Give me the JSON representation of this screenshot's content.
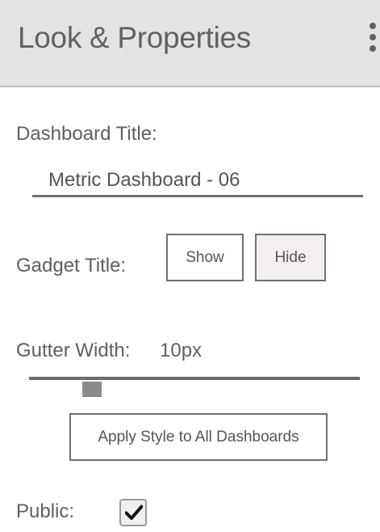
{
  "header": {
    "title": "Look & Properties",
    "menu_icon": "kebab-menu-icon"
  },
  "dashboard_title": {
    "label": "Dashboard Title:",
    "value": "Metric Dashboard - 06"
  },
  "gadget_title": {
    "label": "Gadget Title:",
    "show_label": "Show",
    "hide_label": "Hide",
    "selected": "Hide"
  },
  "gutter_width": {
    "label": "Gutter Width:",
    "value_text": "10px",
    "slider_level": 0.17
  },
  "apply_button": {
    "label": "Apply Style to All Dashboards"
  },
  "public": {
    "label": "Public:",
    "checked": true,
    "check_icon": "checkmark-icon"
  }
}
